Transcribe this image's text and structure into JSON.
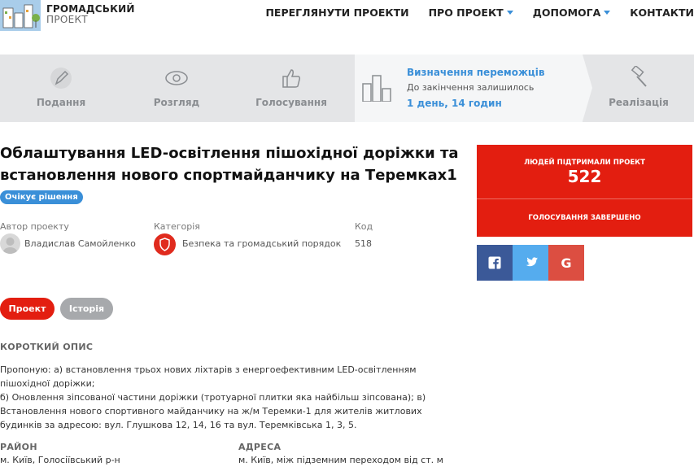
{
  "logo": {
    "line1": "ГРОМАДСЬКИЙ",
    "line2": "ПРОЕКТ"
  },
  "nav": [
    {
      "label": "ПЕРЕГЛЯНУТИ ПРОЕКТИ"
    },
    {
      "label": "ПРО ПРОЕКТ"
    },
    {
      "label": "ДОПОМОГА"
    },
    {
      "label": "КОНТАКТИ"
    }
  ],
  "stages": {
    "submit": "Подання",
    "review": "Розгляд",
    "voting": "Голосування",
    "active_title": "Визначення переможців",
    "active_sub": "До закінчення залишилось",
    "active_time": "1 день, 14 годин",
    "implementation": "Реалізація"
  },
  "project": {
    "title": "Облаштування LED-освітлення пішохідної доріжки та встановлення нового спортмайданчику на Теремках1",
    "status": "Очікує рішення",
    "author_label": "Автор проекту",
    "author": "Владислав Самойленко",
    "category_label": "Категорія",
    "category": "Безпека та громадський порядок",
    "code_label": "Код",
    "code": "518"
  },
  "support": {
    "label": "ЛЮДЕЙ ПІДТРИМАЛИ ПРОЕКТ",
    "count": "522",
    "voting_status": "ГОЛОСУВАННЯ ЗАВЕРШЕНО"
  },
  "tabs": {
    "project": "Проект",
    "history": "Історія"
  },
  "description": {
    "title": "КОРОТКИЙ ОПИС",
    "line1": "Пропоную: а) встановлення трьох нових ліхтарів з енергоефективним LED-освітленням пішохідної доріжки;",
    "line2": "б) Оновлення зіпсованої частини доріжки (тротуарної плитки яка найбільш зіпсована); в) Встановлення нового спортивного майданчику на ж/м Теремки-1 для жителів житлових будинків за адресою: вул. Глушкова 12, 14, 16 та вул. Теремківська 1, 3, 5."
  },
  "district": {
    "label": "РАЙОН",
    "value": "м. Київ, Голосіївський р-н"
  },
  "address": {
    "label": "АДРЕСА",
    "value": "м. Київ, між підземним переходом від ст. м"
  },
  "colors": {
    "accent": "#3a8fd8",
    "red": "#e31e10",
    "facebook": "#3b5998",
    "twitter": "#55acee",
    "google": "#dc4e41"
  }
}
